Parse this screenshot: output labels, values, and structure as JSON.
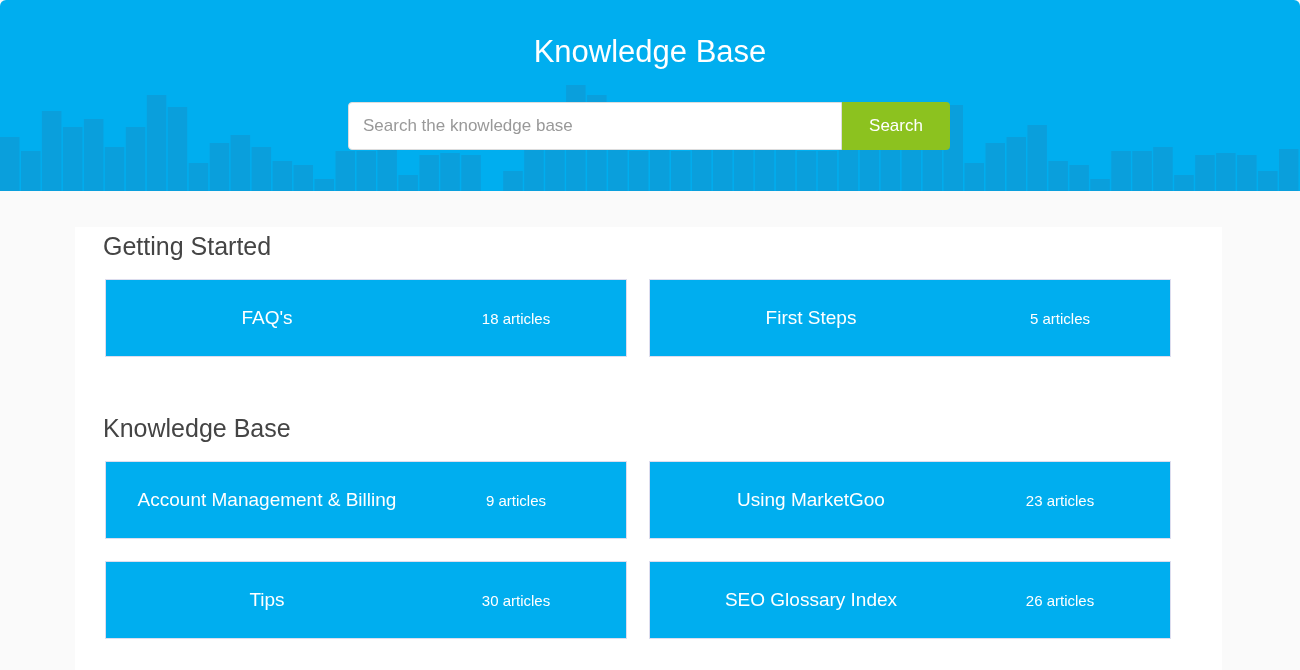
{
  "header": {
    "title": "Knowledge Base",
    "search": {
      "placeholder": "Search the knowledge base",
      "button": "Search"
    }
  },
  "sections": [
    {
      "title": "Getting Started",
      "categories": [
        {
          "name": "FAQ's",
          "count": "18 articles"
        },
        {
          "name": "First Steps",
          "count": "5 articles"
        }
      ]
    },
    {
      "title": "Knowledge Base",
      "categories": [
        {
          "name": "Account Management & Billing",
          "count": "9 articles"
        },
        {
          "name": "Using MarketGoo",
          "count": "23 articles"
        },
        {
          "name": "Tips",
          "count": "30 articles"
        },
        {
          "name": "SEO Glossary Index",
          "count": "26 articles"
        }
      ]
    }
  ]
}
